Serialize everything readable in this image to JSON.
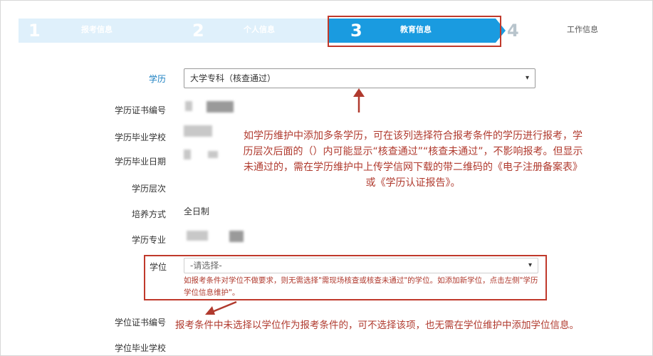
{
  "steps": [
    {
      "num": "1",
      "label": "报考信息"
    },
    {
      "num": "2",
      "label": "个人信息"
    },
    {
      "num": "3",
      "label": "教育信息"
    },
    {
      "num": "4",
      "label": "工作信息"
    }
  ],
  "form": {
    "education_label": "学历",
    "education_value": "大学专科（核查通过）",
    "cert_no_label": "学历证书编号",
    "school_label": "学历毕业学校",
    "grad_date_label": "学历毕业日期",
    "level_label": "学历层次",
    "mode_label": "培养方式",
    "mode_value": "全日制",
    "major_label": "学历专业",
    "degree_label": "学位",
    "degree_placeholder": "-请选择-",
    "degree_hint": "如报考条件对学位不做要求，则无需选择\"需现场核查或核查未通过\"的学位。如添加新学位，点击左侧\"学历学位信息维护\"。",
    "degree_cert_label": "学位证书编号",
    "degree_school_label": "学位毕业学校"
  },
  "annotations": {
    "education_note": "如学历维护中添加多条学历，可在该列选择符合报考条件的学历进行报考，学历层次后面的（）内可能显示“核查通过”“核查未通过”，不影响报考。但显示未通过的，需在学历维护中上传学信网下载的带二维码的《电子注册备案表》或《学历认证报告》。",
    "degree_note": "报考条件中未选择以学位作为报考条件的，可不选择该项，也无需在学位维护中添加学位信息。"
  },
  "colors": {
    "active_step": "#1a9be0",
    "inactive_step": "#dff0fb",
    "annotation": "#b03a2e"
  }
}
